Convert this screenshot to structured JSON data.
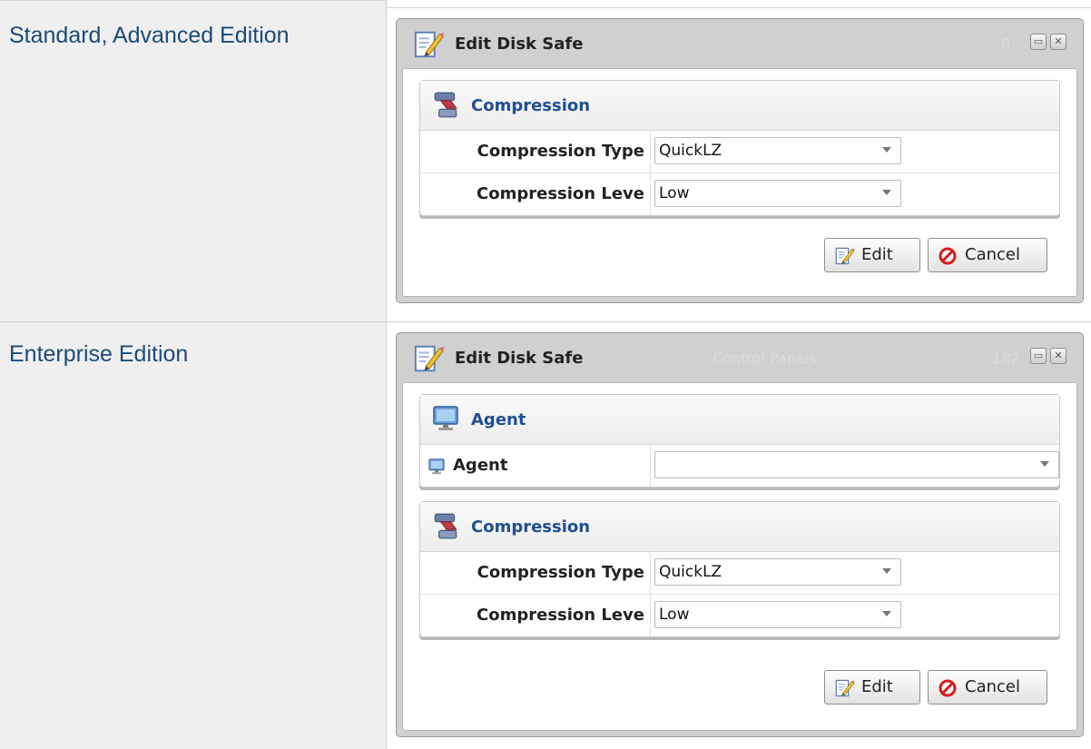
{
  "editions": [
    {
      "label": "Standard, Advanced Edition",
      "dialog": {
        "title": "Edit Disk Safe",
        "ghost_text_right": "0",
        "window_buttons": [
          "maximize",
          "close"
        ],
        "panels": [
          {
            "title": "Compression",
            "icon": "compression-icon",
            "fields": [
              {
                "label": "Compression Type",
                "value": "QuickLZ"
              },
              {
                "label": "Compression Leve",
                "value": "Low"
              }
            ]
          }
        ],
        "buttons": {
          "edit": "Edit",
          "cancel": "Cancel"
        }
      }
    },
    {
      "label": "Enterprise Edition",
      "dialog": {
        "title": "Edit Disk Safe",
        "ghost_text_center": "Control Panels",
        "ghost_text_right": "182",
        "window_buttons": [
          "maximize",
          "close"
        ],
        "panels": [
          {
            "title": "Agent",
            "icon": "monitor-icon",
            "fields": [
              {
                "label": "Agent",
                "value": ""
              }
            ]
          },
          {
            "title": "Compression",
            "icon": "compression-icon",
            "fields": [
              {
                "label": "Compression Type",
                "value": "QuickLZ"
              },
              {
                "label": "Compression Leve",
                "value": "Low"
              }
            ]
          }
        ],
        "buttons": {
          "edit": "Edit",
          "cancel": "Cancel"
        }
      }
    }
  ],
  "colors": {
    "edition_label": "#1d4a78",
    "panel_title": "#1f4f91",
    "cancel_icon": "#d21f1f"
  }
}
